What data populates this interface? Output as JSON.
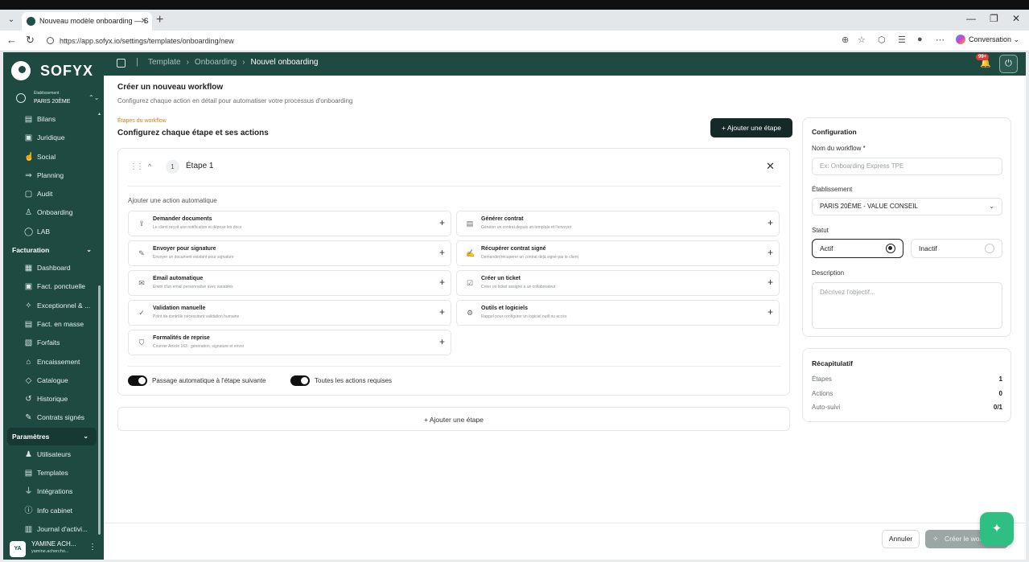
{
  "browser": {
    "tab_title": "Nouveau modèle onboarding — S",
    "url": "https://app.sofyx.io/settings/templates/onboarding/new",
    "conversation": "Conversation"
  },
  "sidebar": {
    "logo": "SOFYX",
    "establishment_label": "Établissement",
    "establishment_value": "PARIS 20ÈME",
    "items_top": [
      {
        "label": "Bilans",
        "icon": "bilan-icon"
      },
      {
        "label": "Juridique",
        "icon": "legal-icon"
      },
      {
        "label": "Social",
        "icon": "thumbs-up-icon"
      },
      {
        "label": "Planning",
        "icon": "planning-icon"
      },
      {
        "label": "Audit",
        "icon": "audit-icon"
      },
      {
        "label": "Onboarding",
        "icon": "onboarding-icon"
      },
      {
        "label": "LAB",
        "icon": "lab-icon"
      }
    ],
    "section_billing": "Facturation",
    "items_billing": [
      {
        "label": "Dashboard",
        "icon": "dashboard-icon"
      },
      {
        "label": "Fact. ponctuelle",
        "icon": "invoice-icon"
      },
      {
        "label": "Exceptionnel & ...",
        "icon": "sparkle-icon"
      },
      {
        "label": "Fact. en masse",
        "icon": "bulk-invoice-icon"
      },
      {
        "label": "Forfaits",
        "icon": "package-icon"
      },
      {
        "label": "Encaissement",
        "icon": "bank-icon"
      },
      {
        "label": "Catalogue",
        "icon": "tag-icon"
      },
      {
        "label": "Historique",
        "icon": "history-icon"
      },
      {
        "label": "Contrats signés",
        "icon": "signed-contract-icon"
      }
    ],
    "section_settings": "Paramètres",
    "items_settings": [
      {
        "label": "Utilisateurs",
        "icon": "users-icon"
      },
      {
        "label": "Templates",
        "icon": "template-icon"
      },
      {
        "label": "Intégrations",
        "icon": "plug-icon"
      },
      {
        "label": "Info cabinet",
        "icon": "info-icon"
      },
      {
        "label": "Journal d'activi...",
        "icon": "journal-icon"
      }
    ],
    "user": {
      "initials": "YA",
      "name": "YAMINE ACH...",
      "email": "yamine.achercho..."
    }
  },
  "header": {
    "crumbs": [
      "Template",
      "Onboarding",
      "Nouvel onboarding"
    ],
    "notif_badge": "99+"
  },
  "main": {
    "title": "Créer un nouveau workflow",
    "subtitle": "Configurez chaque action en détail pour automatiser votre processus d'onboarding",
    "steps_label": "Étapes du workflow",
    "steps_title": "Configurez chaque étape et ses actions",
    "add_step": "Ajouter une étape",
    "step": {
      "number": "1",
      "name": "Étape 1"
    },
    "actions_label": "Ajouter une action automatique",
    "actions": [
      {
        "title": "Demander documents",
        "desc": "Le client reçoit une notification et dépose les docs",
        "icon": "upload-icon"
      },
      {
        "title": "Générer contrat",
        "desc": "Générer un contrat depuis un template et l'envoyer",
        "icon": "document-icon"
      },
      {
        "title": "Envoyer pour signature",
        "desc": "Envoyer un document existant pour signature",
        "icon": "signature-icon"
      },
      {
        "title": "Récupérer contrat signé",
        "desc": "Demander/récupérer un contrat déjà signé par le client",
        "icon": "file-signed-icon"
      },
      {
        "title": "Email automatique",
        "desc": "Envoi d'un email personnalisé avec variables",
        "icon": "mail-icon"
      },
      {
        "title": "Créer un ticket",
        "desc": "Créer un ticket assigné à un collaborateur",
        "icon": "ticket-icon"
      },
      {
        "title": "Validation manuelle",
        "desc": "Point de contrôle nécessitant validation humaine",
        "icon": "check-circle-icon"
      },
      {
        "title": "Outils et logiciels",
        "desc": "Rappel pour configurer un logiciel outil ou accès",
        "icon": "gear-icon"
      },
      {
        "title": "Formalités de reprise",
        "desc": "Courrier Article 163 : génération, signature et envoi",
        "icon": "shield-icon"
      }
    ],
    "toggle_auto": "Passage automatique à l'étape suivante",
    "toggle_required": "Toutes les actions requises",
    "add_step_bottom": "Ajouter une étape"
  },
  "config": {
    "title": "Configuration",
    "name_label": "Nom du workflow *",
    "name_placeholder": "Ex: Onboarding Express TPE",
    "establishment_label": "Établissement",
    "establishment_value": "PARIS 20ÈME - VALUE CONSEIL",
    "status_label": "Statut",
    "status_active": "Actif",
    "status_inactive": "Inactif",
    "description_label": "Description",
    "description_placeholder": "Décrivez l'objectif..."
  },
  "recap": {
    "title": "Récapitulatif",
    "rows": [
      {
        "label": "Étapes",
        "value": "1"
      },
      {
        "label": "Actions",
        "value": "0"
      },
      {
        "label": "Auto-suivi",
        "value": "0/1"
      }
    ]
  },
  "footer": {
    "cancel": "Annuler",
    "create": "Créer le workflow"
  }
}
